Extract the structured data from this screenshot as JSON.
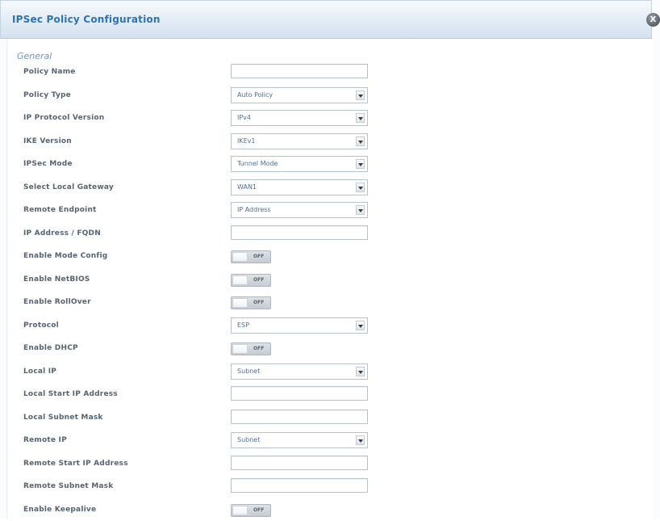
{
  "dialog": {
    "title": "IPSec Policy Configuration",
    "close_label": "X"
  },
  "section": {
    "title": "General"
  },
  "fields": [
    {
      "label": "Policy Name",
      "type": "text",
      "value": ""
    },
    {
      "label": "Policy Type",
      "type": "select",
      "value": "Auto Policy"
    },
    {
      "label": "IP Protocol Version",
      "type": "select",
      "value": "IPv4"
    },
    {
      "label": "IKE Version",
      "type": "select",
      "value": "IKEv1"
    },
    {
      "label": "IPSec Mode",
      "type": "select",
      "value": "Tunnel Mode"
    },
    {
      "label": "Select Local Gateway",
      "type": "select",
      "value": "WAN1"
    },
    {
      "label": "Remote Endpoint",
      "type": "select",
      "value": "IP Address"
    },
    {
      "label": "IP Address / FQDN",
      "type": "text",
      "value": ""
    },
    {
      "label": "Enable Mode Config",
      "type": "toggle",
      "value": "OFF"
    },
    {
      "label": "Enable NetBIOS",
      "type": "toggle",
      "value": "OFF"
    },
    {
      "label": "Enable RollOver",
      "type": "toggle",
      "value": "OFF"
    },
    {
      "label": "Protocol",
      "type": "select",
      "value": "ESP"
    },
    {
      "label": "Enable DHCP",
      "type": "toggle",
      "value": "OFF"
    },
    {
      "label": "Local IP",
      "type": "select",
      "value": "Subnet"
    },
    {
      "label": "Local Start IP Address",
      "type": "text",
      "value": ""
    },
    {
      "label": "Local Subnet Mask",
      "type": "text",
      "value": ""
    },
    {
      "label": "Remote IP",
      "type": "select",
      "value": "Subnet"
    },
    {
      "label": "Remote Start IP Address",
      "type": "text",
      "value": ""
    },
    {
      "label": "Remote Subnet Mask",
      "type": "text",
      "value": ""
    },
    {
      "label": "Enable Keepalive",
      "type": "toggle",
      "value": "OFF"
    }
  ],
  "colors": {
    "title": "#2f73b2",
    "section": "#6b97c6",
    "label": "#566472",
    "select_text": "#4f6f95"
  }
}
